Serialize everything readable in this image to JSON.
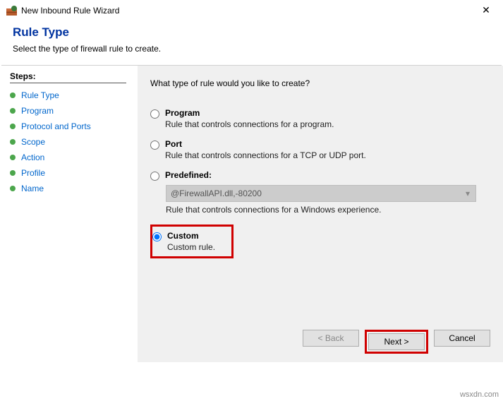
{
  "window": {
    "title": "New Inbound Rule Wizard"
  },
  "header": {
    "title": "Rule Type",
    "subtitle": "Select the type of firewall rule to create."
  },
  "sidebar": {
    "heading": "Steps:",
    "items": [
      {
        "label": "Rule Type"
      },
      {
        "label": "Program"
      },
      {
        "label": "Protocol and Ports"
      },
      {
        "label": "Scope"
      },
      {
        "label": "Action"
      },
      {
        "label": "Profile"
      },
      {
        "label": "Name"
      }
    ]
  },
  "content": {
    "prompt": "What type of rule would you like to create?",
    "options": {
      "program": {
        "label": "Program",
        "desc": "Rule that controls connections for a program."
      },
      "port": {
        "label": "Port",
        "desc": "Rule that controls connections for a TCP or UDP port."
      },
      "predefined": {
        "label": "Predefined:",
        "select_value": "@FirewallAPI.dll,-80200",
        "desc": "Rule that controls connections for a Windows experience."
      },
      "custom": {
        "label": "Custom",
        "desc": "Custom rule."
      }
    }
  },
  "footer": {
    "back": "< Back",
    "next": "Next >",
    "cancel": "Cancel"
  },
  "watermark": "wsxdn.com"
}
